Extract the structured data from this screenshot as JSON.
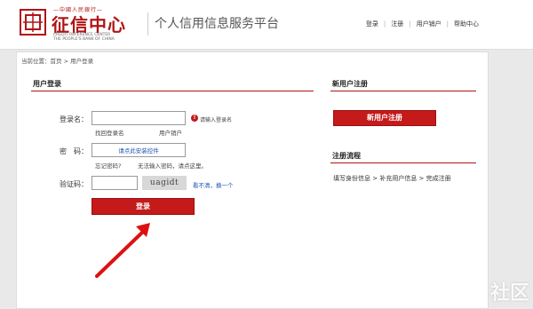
{
  "header": {
    "logo_top": "—中國人民銀行—",
    "logo_cn": "征信中心",
    "logo_en_1": "CREDIT REFERENCE CENTER",
    "logo_en_2": "THE PEOPLE'S BANK OF CHINA",
    "platform_title": "个人信用信息服务平台",
    "links": [
      "登录",
      "注册",
      "用户销户",
      "帮助中心"
    ],
    "link_separator": "|"
  },
  "breadcrumb": {
    "text": "当前位置：首页 > 用户登录"
  },
  "login": {
    "title": "用户登录",
    "username_label": "登录名：",
    "username_value": "",
    "username_hint": "请输入登录名",
    "forgot_username": "找回登录名",
    "cancel_account": "用户销户",
    "password_label": "密　码：",
    "password_control_link": "请点此安装控件",
    "forgot_password": "忘记密码?",
    "cannot_input": "无法输入密码，请点这里。",
    "captcha_label": "验证码：",
    "captcha_value": "",
    "captcha_text": "uagidt",
    "captcha_refresh_prefix": "看不清，",
    "captcha_refresh_link": "换一个",
    "submit_label": "登录"
  },
  "register": {
    "title": "新用户注册",
    "button_label": "新用户注册"
  },
  "process": {
    "title": "注册流程",
    "steps": "填写身份信息 > 补充用户信息 > 完成注册"
  },
  "overlay": {
    "watermark": "社区"
  },
  "colors": {
    "brand_red": "#c41a1a",
    "link_blue": "#1a4fb0"
  }
}
